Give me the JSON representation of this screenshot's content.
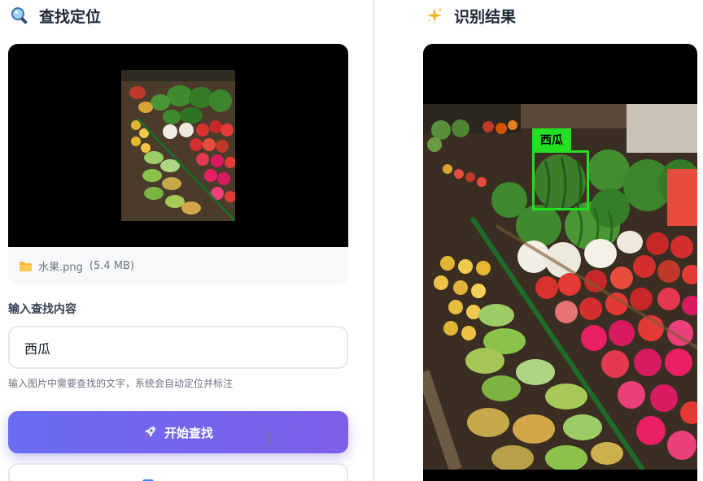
{
  "left_panel": {
    "title": "查找定位",
    "title_icon": "magnifier-icon",
    "file": {
      "name": "水果.png",
      "size": "(5.4 MB)"
    },
    "input_label": "输入查找内容",
    "input_value": "西瓜",
    "hint": "输入图片中需要查找的文字，系统会自动定位并标注",
    "start_button_label": "开始查找",
    "start_button_icon": "rocket-icon"
  },
  "right_panel": {
    "title": "识别结果",
    "title_icon": "sparkles-icon",
    "detection_label": "西瓜"
  },
  "colors": {
    "accent_start": "#6a6cf2",
    "accent_end": "#7f5fe8",
    "detection": "#22e022"
  }
}
